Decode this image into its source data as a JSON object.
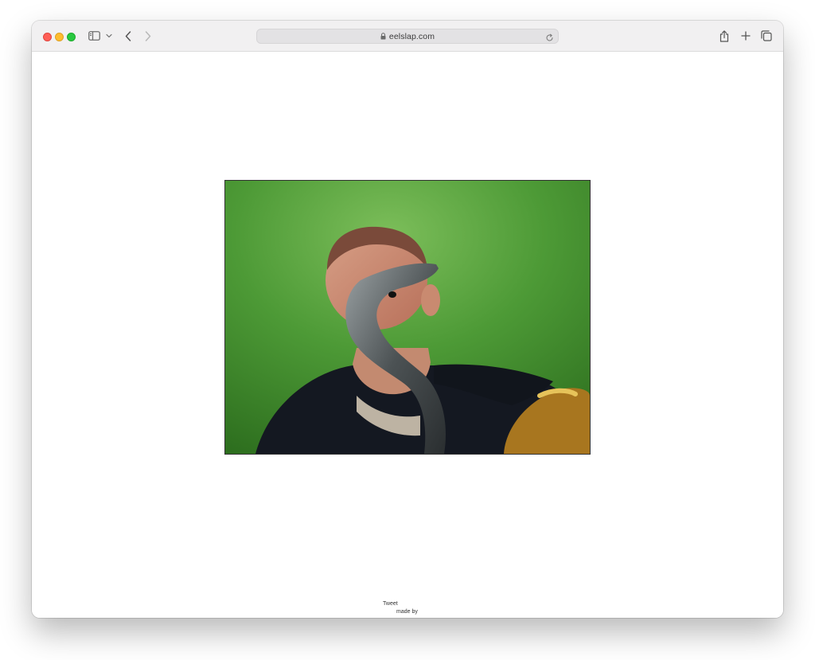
{
  "browser": {
    "url": "eelslap.com",
    "secure": true
  },
  "page": {
    "footer": {
      "tweet_label": "Tweet",
      "made_by_label": "made by"
    }
  },
  "colors": {
    "toolbar_bg": "#f1f0f1",
    "close": "#ff5f57",
    "minimize": "#febc2e",
    "maximize": "#28c840",
    "green_screen": "#3d8a2b"
  },
  "icons": {
    "sidebar": "sidebar-icon",
    "chevron": "chevron-down-icon",
    "back": "chevron-left-icon",
    "forward": "chevron-right-icon",
    "lock": "lock-icon",
    "reload": "reload-icon",
    "share": "share-icon",
    "new_tab": "plus-icon",
    "tab_overview": "tab-overview-icon"
  }
}
